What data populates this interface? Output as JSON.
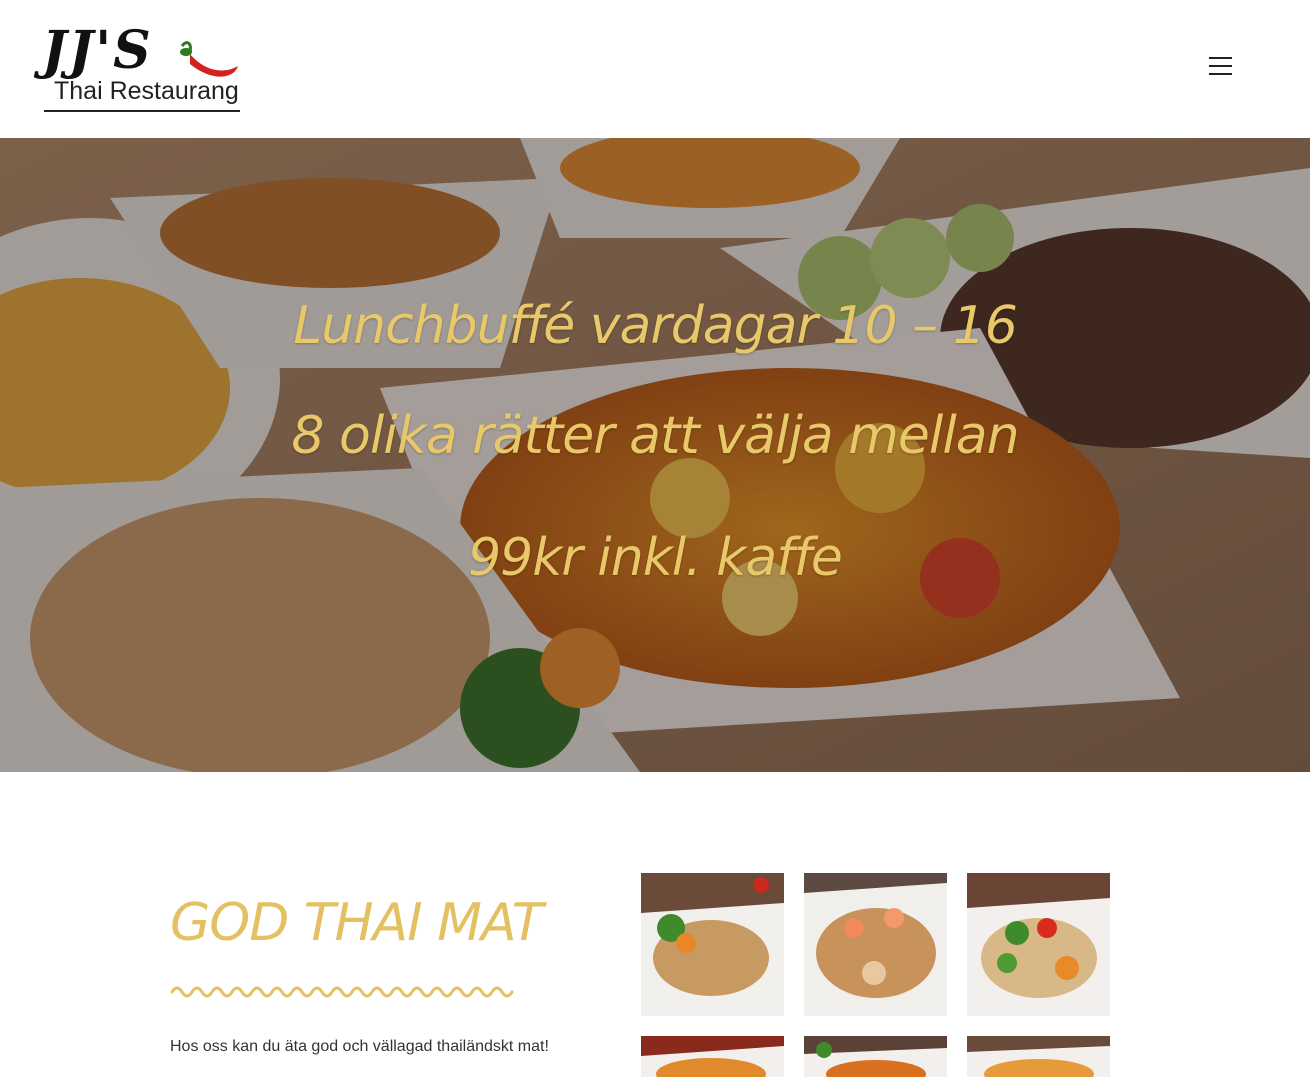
{
  "header": {
    "logo": {
      "name": "JJ'S",
      "subtitle": "Thai Restaurang"
    },
    "menu_icon": "hamburger-menu-icon"
  },
  "hero": {
    "lines": [
      "Lunchbuffé vardagar 10 – 16",
      "8 olika rätter att välja mellan",
      "99kr inkl. kaffe"
    ],
    "text_color": "#e8c869"
  },
  "intro": {
    "title": "GOD THAI MAT",
    "text": "Hos oss kan du äta god och vällagad thailändskt mat!",
    "accent_color": "#e3c163"
  },
  "gallery": {
    "items": [
      {
        "icon": "food-photo"
      },
      {
        "icon": "food-photo"
      },
      {
        "icon": "food-photo"
      },
      {
        "icon": "food-photo"
      },
      {
        "icon": "food-photo"
      },
      {
        "icon": "food-photo"
      }
    ]
  }
}
